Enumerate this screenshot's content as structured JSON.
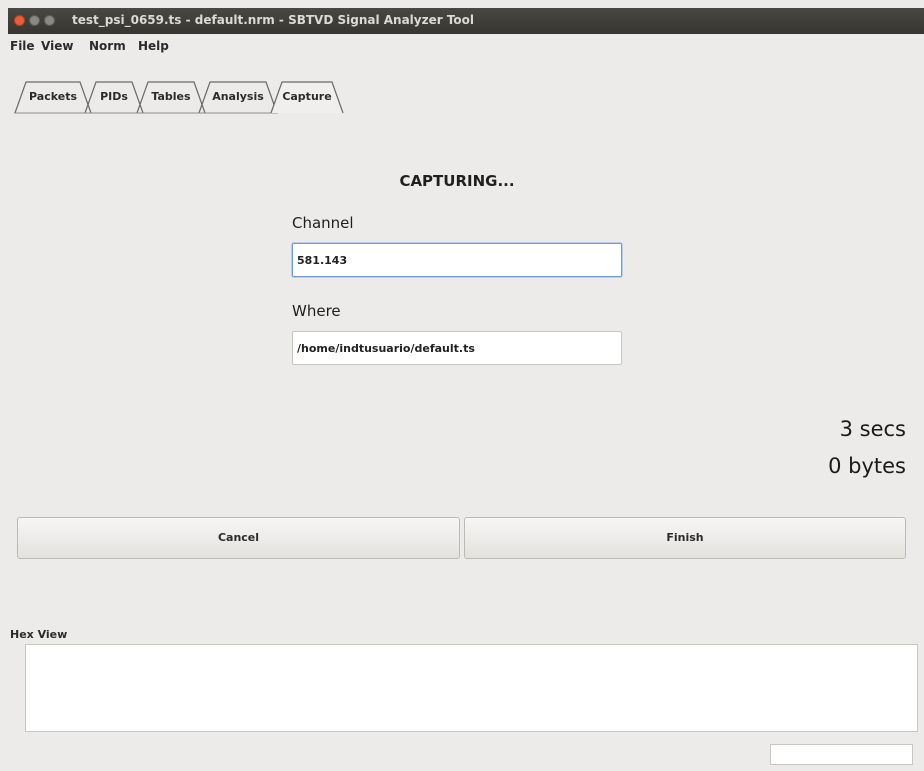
{
  "window": {
    "title": "test_psi_0659.ts - default.nrm - SBTVD Signal Analyzer Tool"
  },
  "menu": {
    "items": [
      "File",
      "View",
      "Norm",
      "Help"
    ]
  },
  "tabs": [
    {
      "label": "Packets",
      "active": false
    },
    {
      "label": "PIDs",
      "active": false
    },
    {
      "label": "Tables",
      "active": false
    },
    {
      "label": "Analysis",
      "active": false
    },
    {
      "label": "Capture",
      "active": true
    }
  ],
  "capture": {
    "status": "CAPTURING...",
    "channel_label": "Channel",
    "channel_value": "581.143",
    "where_label": "Where",
    "where_value": "/home/indtusuario/default.ts",
    "elapsed": "3 secs",
    "bytes": "0 bytes",
    "cancel_label": "Cancel",
    "finish_label": "Finish"
  },
  "hex_view": {
    "label": "Hex View"
  },
  "colors": {
    "titlebar": "#3c3b37",
    "close_button": "#e95d39",
    "window_bg": "#edebea",
    "focus_border": "#6f9bd8"
  },
  "icons": {
    "close": "close-icon",
    "minimize": "minimize-icon",
    "maximize": "maximize-icon"
  }
}
